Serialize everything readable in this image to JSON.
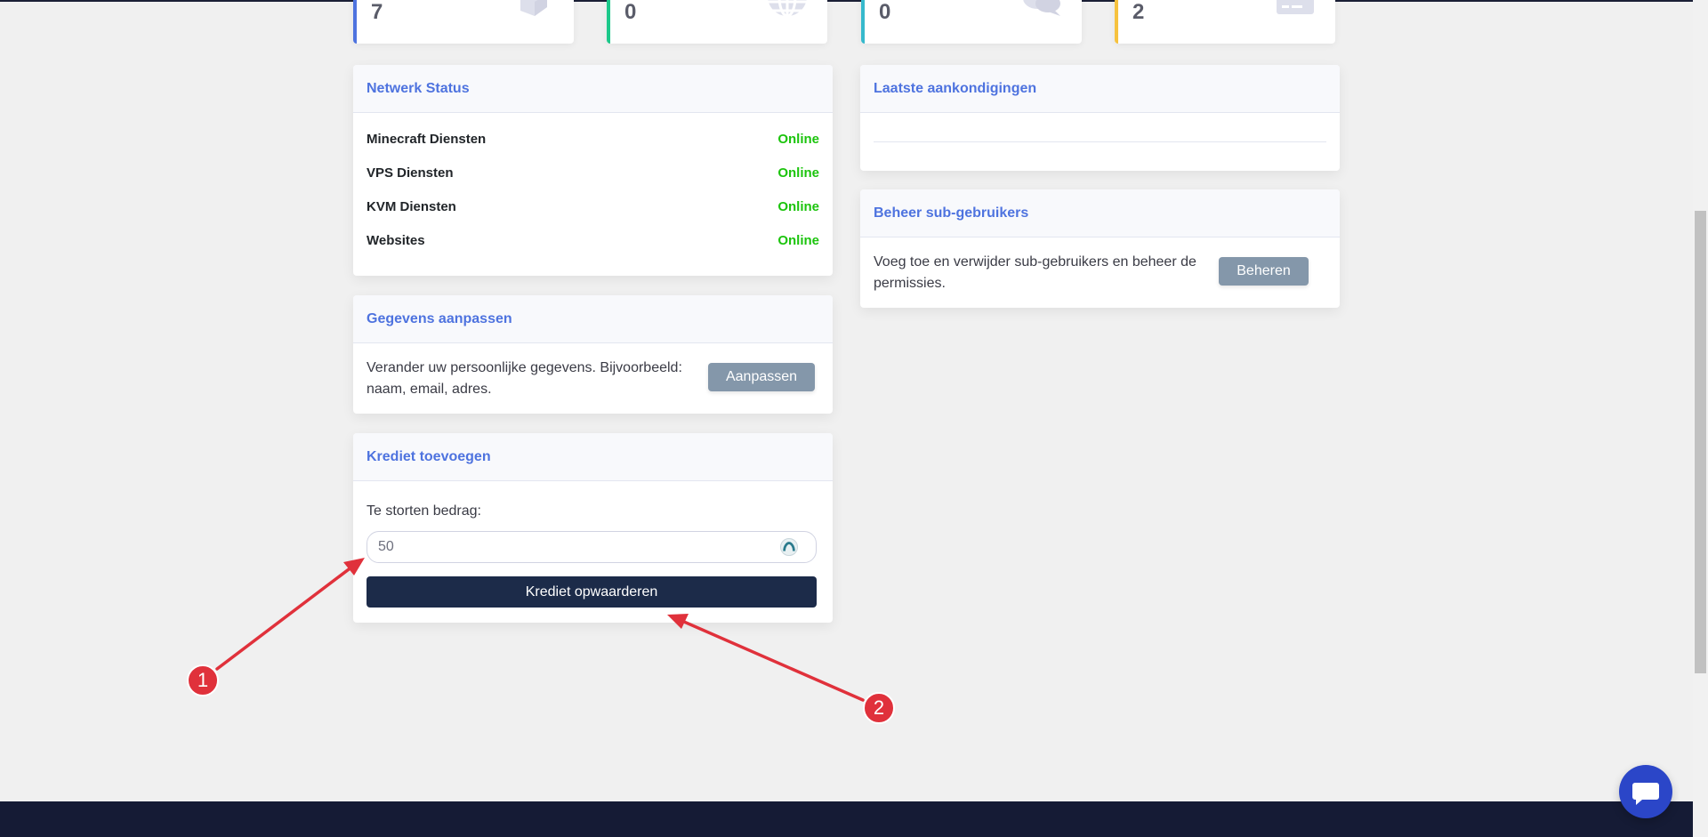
{
  "stats": [
    {
      "value": "7",
      "color": "#4e73df",
      "icon": "box-icon"
    },
    {
      "value": "0",
      "color": "#1cc88a",
      "icon": "globe-icon"
    },
    {
      "value": "0",
      "color": "#36b9cc",
      "icon": "comments-icon"
    },
    {
      "value": "2",
      "color": "#f6c23e",
      "icon": "credit-card-icon"
    }
  ],
  "network_status": {
    "title": "Netwerk Status",
    "items": [
      {
        "name": "Minecraft Diensten",
        "status": "Online"
      },
      {
        "name": "VPS Diensten",
        "status": "Online"
      },
      {
        "name": "KVM Diensten",
        "status": "Online"
      },
      {
        "name": "Websites",
        "status": "Online"
      }
    ]
  },
  "announcements": {
    "title": "Laatste aankondigingen"
  },
  "subusers": {
    "title": "Beheer sub-gebruikers",
    "text": "Voeg toe en verwijder sub-gebruikers en beheer de permissies.",
    "button": "Beheren"
  },
  "edit_details": {
    "title": "Gegevens aanpassen",
    "text": "Verander uw persoonlijke gegevens. Bijvoorbeeld: naam, email, adres.",
    "button": "Aanpassen"
  },
  "credit": {
    "title": "Krediet toevoegen",
    "label": "Te storten bedrag:",
    "amount": "50",
    "button": "Krediet opwaarderen"
  },
  "annotations": [
    {
      "label": "1"
    },
    {
      "label": "2"
    }
  ],
  "colors": {
    "accent": "#4e73df",
    "online": "#1cc40d",
    "primary_button": "#1c2b49",
    "secondary_button": "#8497aa",
    "annotation": "#e0313b",
    "footer": "#151b35",
    "chat": "#2b46c8"
  }
}
